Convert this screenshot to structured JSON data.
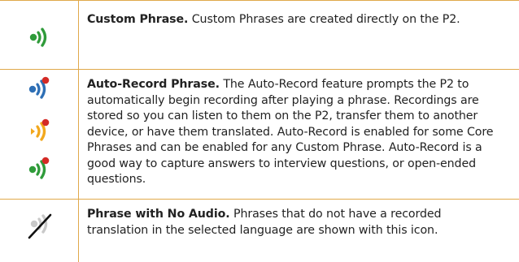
{
  "rows": [
    {
      "title": "Custom Phrase.",
      "body": " Custom Phrases are created directly on the P2.",
      "icons": [
        "speaker-green-icon"
      ]
    },
    {
      "title": "Auto-Record Phrase.",
      "body": " The Auto-Record feature prompts the P2 to automatically begin recording after playing a phrase. Recordings are stored so you can listen to them on the P2, transfer them to another device, or have them translated. Auto-Record is enabled for some Core Phrases and can be enabled for any Custom Phrase. Auto-Record is a good way to capture answers to interview questions, or open-ended questions.",
      "icons": [
        "speaker-blue-record-icon",
        "speaker-orange-record-icon",
        "speaker-green-record-icon"
      ]
    },
    {
      "title": "Phrase with No Audio.",
      "body": " Phrases that do not have a recorded translation in the selected language are shown with this icon.",
      "icons": [
        "speaker-no-audio-icon"
      ]
    }
  ],
  "colors": {
    "rule": "#e0a94a",
    "green": "#2f9b3a",
    "blue": "#2e6fb5",
    "orange": "#f2a81d",
    "record_red": "#d42a25",
    "grey": "#c9c9c9"
  }
}
